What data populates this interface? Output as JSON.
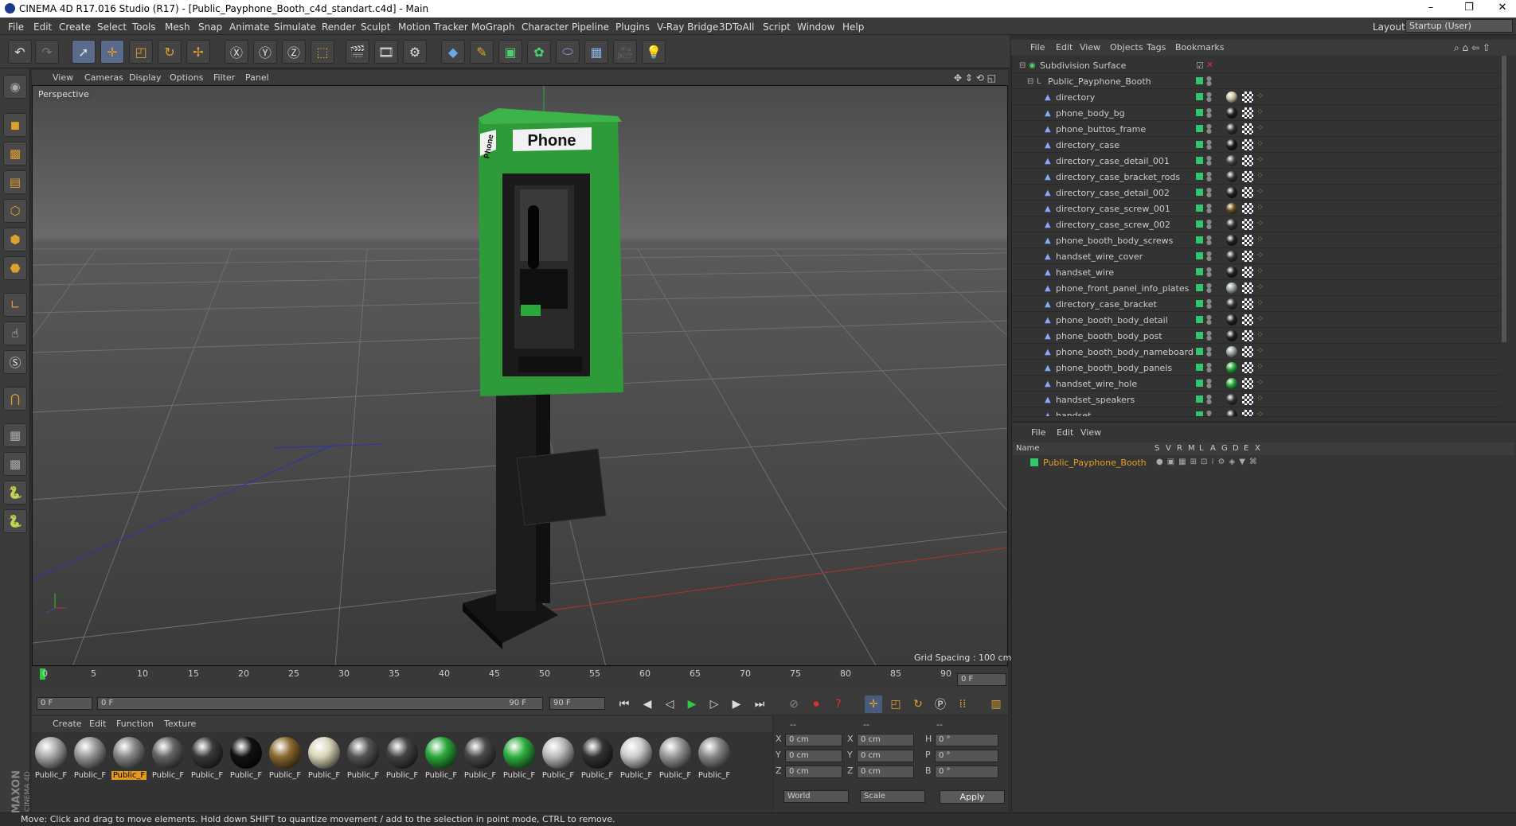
{
  "window": {
    "title": "CINEMA 4D R17.016 Studio (R17) - [Public_Payphone_Booth_c4d_standart.c4d] - Main",
    "min": "–",
    "max": "❐",
    "close": "✕"
  },
  "menubar": {
    "items": [
      "File",
      "Edit",
      "Create",
      "Select",
      "Tools",
      "Mesh",
      "Snap",
      "Animate",
      "Simulate",
      "Render",
      "Sculpt",
      "Motion Tracker",
      "MoGraph",
      "Character",
      "Pipeline",
      "Plugins",
      "V-Ray Bridge",
      "3DToAll",
      "Script",
      "Window",
      "Help"
    ],
    "layout_label": "Layout:",
    "layout_value": "Startup (User)"
  },
  "viewport": {
    "menu": [
      "View",
      "Cameras",
      "Display",
      "Options",
      "Filter",
      "Panel"
    ],
    "label": "Perspective",
    "grid_spacing": "Grid Spacing : 100 cm",
    "sign_text": "Phone",
    "side_text": "Phone"
  },
  "timeline": {
    "ticks": [
      "0",
      "5",
      "10",
      "15",
      "20",
      "25",
      "30",
      "35",
      "40",
      "45",
      "50",
      "55",
      "60",
      "65",
      "70",
      "75",
      "80",
      "85",
      "90"
    ],
    "current": "0 F",
    "start": "0 F",
    "range_start": "0 F",
    "range_end": "90 F",
    "end": "90 F"
  },
  "materials": {
    "menu": [
      "Create",
      "Edit",
      "Function",
      "Texture"
    ],
    "items": [
      {
        "label": "Public_F",
        "color": "#aaaaaa",
        "selected": false
      },
      {
        "label": "Public_F",
        "color": "#999999",
        "selected": false
      },
      {
        "label": "Public_F",
        "color": "#888888",
        "selected": true
      },
      {
        "label": "Public_F",
        "color": "#666666",
        "selected": false
      },
      {
        "label": "Public_F",
        "color": "#3a3a3a",
        "selected": false
      },
      {
        "label": "Public_F",
        "color": "#111111",
        "selected": false
      },
      {
        "label": "Public_F",
        "color": "#8a6a30",
        "selected": false
      },
      {
        "label": "Public_F",
        "color": "#d8d4b8",
        "selected": false
      },
      {
        "label": "Public_F",
        "color": "#555555",
        "selected": false
      },
      {
        "label": "Public_F",
        "color": "#444444",
        "selected": false
      },
      {
        "label": "Public_F",
        "color": "#2aa83a",
        "selected": false
      },
      {
        "label": "Public_F",
        "color": "#4a4a4a",
        "selected": false
      },
      {
        "label": "Public_F",
        "color": "#30b040",
        "selected": false
      },
      {
        "label": "Public_F",
        "color": "#bbbbbb",
        "selected": false
      },
      {
        "label": "Public_F",
        "color": "#333333",
        "selected": false
      },
      {
        "label": "Public_F",
        "color": "#cccccc",
        "selected": false
      },
      {
        "label": "Public_F",
        "color": "#999999",
        "selected": false
      },
      {
        "label": "Public_F",
        "color": "#888888",
        "selected": false
      }
    ]
  },
  "coords": {
    "headers": [
      "--",
      "--",
      "--"
    ],
    "rows": [
      {
        "a": "X",
        "av": "0 cm",
        "b": "X",
        "bv": "0 cm",
        "c": "H",
        "cv": "0 °"
      },
      {
        "a": "Y",
        "av": "0 cm",
        "b": "Y",
        "bv": "0 cm",
        "c": "P",
        "cv": "0 °"
      },
      {
        "a": "Z",
        "av": "0 cm",
        "b": "Z",
        "bv": "0 cm",
        "c": "B",
        "cv": "0 °"
      }
    ],
    "world": "World",
    "scale": "Scale",
    "apply": "Apply"
  },
  "objects": {
    "menu": [
      "File",
      "Edit",
      "View",
      "Objects",
      "Tags",
      "Bookmarks"
    ],
    "root": "Subdivision Surface",
    "group": "Public_Payphone_Booth",
    "items": [
      "directory",
      "phone_body_bg",
      "phone_buttos_frame",
      "directory_case",
      "directory_case_detail_001",
      "directory_case_bracket_rods",
      "directory_case_detail_002",
      "directory_case_screw_001",
      "directory_case_screw_002",
      "phone_booth_body_screws",
      "handset_wire_cover",
      "handset_wire",
      "phone_front_panel_info_plates",
      "directory_case_bracket",
      "phone_booth_body_detail",
      "phone_booth_body_post",
      "phone_booth_body_nameboard",
      "phone_booth_body_panels",
      "handset_wire_hole",
      "handset_speakers",
      "handset"
    ],
    "tag_colors": [
      "#c8c0a0",
      "#222222",
      "#333333",
      "#1a1a1a",
      "#444444",
      "#333333",
      "#222222",
      "#6a5020",
      "#333333",
      "#222222",
      "#333333",
      "#222222",
      "#9aa0a0",
      "#333333",
      "#222222",
      "#222222",
      "#9aa0a0",
      "#2aa83a",
      "#2aa83a",
      "#333333",
      "#222222"
    ]
  },
  "layers": {
    "menu": [
      "File",
      "Edit",
      "View"
    ],
    "headers": [
      "Name",
      "S",
      "V",
      "R",
      "M",
      "L",
      "A",
      "G",
      "D",
      "E",
      "X"
    ],
    "row": "Public_Payphone_Booth"
  },
  "status": "Move: Click and drag to move elements. Hold down SHIFT to quantize movement / add to the selection in point mode, CTRL to remove.",
  "brand": {
    "maxon": "MAXON",
    "c4d": "CINEMA 4D"
  }
}
